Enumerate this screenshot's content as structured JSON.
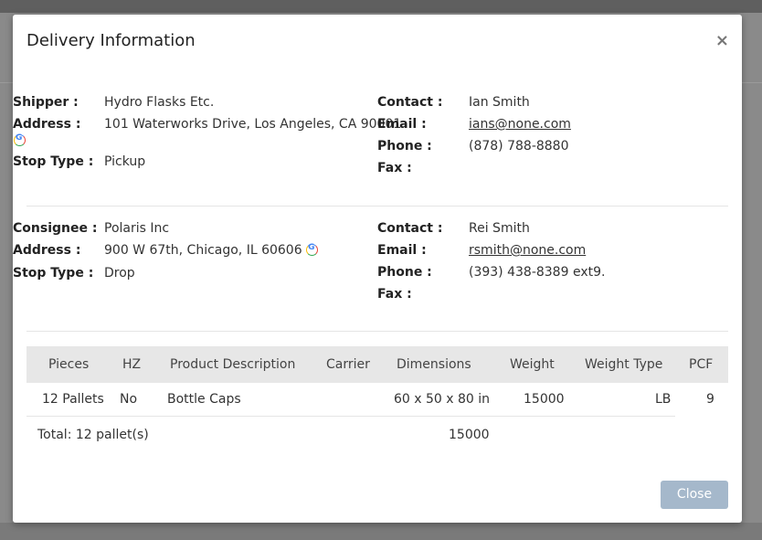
{
  "modal": {
    "title": "Delivery Information",
    "close_icon": "×",
    "close_button_label": "Close"
  },
  "shipper": {
    "label": "Shipper :",
    "name": "Hydro Flasks Etc.",
    "address_label": "Address :",
    "address": "101 Waterworks Drive, Los Angeles, CA 90001",
    "stop_type_label": "Stop Type :",
    "stop_type": "Pickup",
    "contact_label": "Contact :",
    "contact": "Ian Smith",
    "email_label": "Email :",
    "email": "ians@none.com",
    "phone_label": "Phone :",
    "phone": "(878) 788-8880",
    "fax_label": "Fax :",
    "fax": ""
  },
  "consignee": {
    "label": "Consignee :",
    "name": "Polaris Inc",
    "address_label": "Address :",
    "address": "900 W 67th, Chicago, IL 60606",
    "stop_type_label": "Stop Type :",
    "stop_type": "Drop",
    "contact_label": "Contact :",
    "contact": "Rei Smith",
    "email_label": "Email :",
    "email": "rsmith@none.com",
    "phone_label": "Phone :",
    "phone": "(393) 438-8389 ext9.",
    "fax_label": "Fax :",
    "fax": ""
  },
  "table": {
    "headers": [
      "Pieces",
      "HZ",
      "Product Description",
      "Carrier",
      "Dimensions",
      "Weight",
      "Weight Type",
      "PCF"
    ],
    "rows": [
      [
        "12 Pallets",
        "No",
        "Bottle Caps",
        "",
        "60 x 50 x 80 in",
        "15000",
        "LB",
        "9"
      ]
    ],
    "total_label": "Total: 12 pallet(s)",
    "total_weight": "15000"
  },
  "icons": {
    "google_maps_icon": "google-icon"
  }
}
